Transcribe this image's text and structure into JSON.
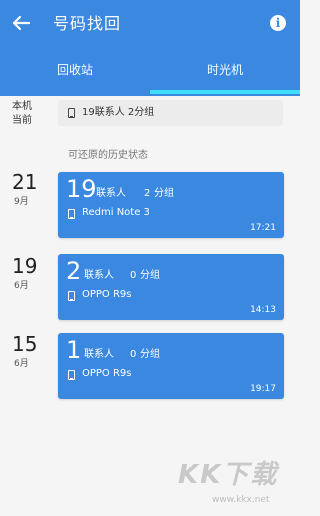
{
  "header": {
    "title": "号码找回",
    "back_icon": "arrow-left-icon",
    "info_icon": "info-icon",
    "info_glyph": "i",
    "accent_color": "#3a88e0",
    "tabs": [
      {
        "label": "回收站",
        "selected": false
      },
      {
        "label": "时光机",
        "selected": true
      }
    ],
    "indicator_color": "#3fe0ff"
  },
  "local": {
    "label": "本机\n当前",
    "summary": "19联系人   2分组",
    "icon": "phone-icon"
  },
  "history": {
    "heading": "可还原的历史状态",
    "snapshots": [
      {
        "day": "21",
        "month": "9月",
        "contact_count": "19",
        "contacts_label": "联系人",
        "group_count": "2",
        "groups_label": "分组",
        "device": "Redmi Note 3",
        "time": "17:21"
      },
      {
        "day": "19",
        "month": "6月",
        "contact_count": "2",
        "contacts_label": "联系人",
        "group_count": "0",
        "groups_label": "分组",
        "device": "OPPO R9s",
        "time": "14:13"
      },
      {
        "day": "15",
        "month": "6月",
        "contact_count": "1",
        "contacts_label": "联系人",
        "group_count": "0",
        "groups_label": "分组",
        "device": "OPPO R9s",
        "time": "19:17"
      }
    ]
  },
  "watermark": {
    "text": "KK下载",
    "url": "www.kkx.net"
  }
}
